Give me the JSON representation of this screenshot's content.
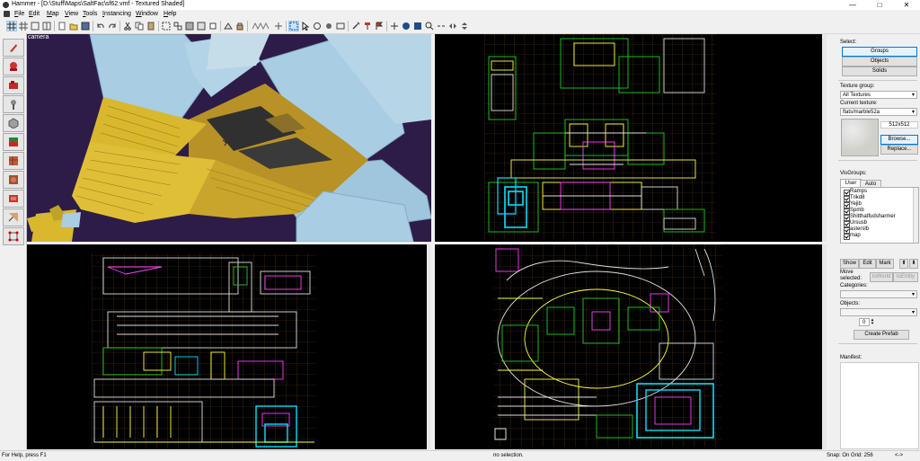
{
  "window": {
    "title": "Hammer - [D:\\Stuff\\Maps\\SaltFac\\sf62.vmf - Textured Shaded]",
    "minimize": "—",
    "maximize": "□",
    "close": "✕"
  },
  "menu": [
    "File",
    "Edit",
    "Map",
    "View",
    "Tools",
    "Instancing",
    "Window",
    "Help"
  ],
  "viewports": {
    "camera_label": "camera"
  },
  "panel": {
    "select_label": "Select:",
    "select_buttons": [
      "Groups",
      "Objects",
      "Solids"
    ],
    "texture_group_label": "Texture group:",
    "texture_group_value": "All Textures",
    "current_texture_label": "Current texture:",
    "current_texture_value": "flats/marble52a",
    "texture_size": "512x512",
    "browse_label": "Browse...",
    "replace_label": "Replace...",
    "visgroups_label": "VisGroups:",
    "visgroup_tabs": [
      "User",
      "Auto"
    ],
    "visgroups": [
      "Ramps",
      "Trikd8",
      "Yejib",
      "Spmb",
      "Shitthatfudsharmer",
      "Ursusb",
      "asterslb",
      "map"
    ],
    "vg_buttons": [
      "Show",
      "Edit",
      "Mark"
    ],
    "move_selected_label": "Move selected:",
    "to_world": "toWorld",
    "to_entity": "toEntity",
    "categories_label": "Categories:",
    "objects_label": "Objects:",
    "objects_count": "0",
    "create_prefab": "Create Prefab",
    "manifest_label": "Manifest:"
  },
  "status": {
    "help": "For Help, press F1",
    "selection": "no selection.",
    "snap": "Snap: On Grid: 256",
    "arrows": "<->"
  },
  "colors": {
    "camera_bg": "#2d1c48",
    "brush_yellow": "#d9b82e",
    "brush_blue": "#a9cde3",
    "grid": "#5c3a12"
  }
}
